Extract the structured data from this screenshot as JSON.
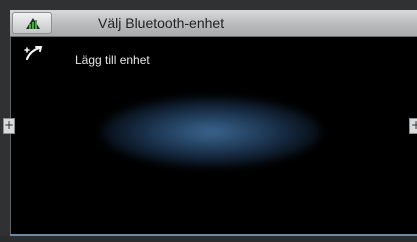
{
  "header": {
    "title": "Välj Bluetooth-enhet",
    "home_icon": "home-icon"
  },
  "list": {
    "items": [
      {
        "label": "Lägg till enhet",
        "icon": "add-phone-icon"
      }
    ]
  },
  "side_controls": {
    "left_symbol": "+",
    "right_symbol": "+"
  },
  "colors": {
    "header_top": "#d6d8da",
    "screen_bg": "#000000",
    "glow": "#4678aa",
    "text": "#e6e6e6"
  }
}
